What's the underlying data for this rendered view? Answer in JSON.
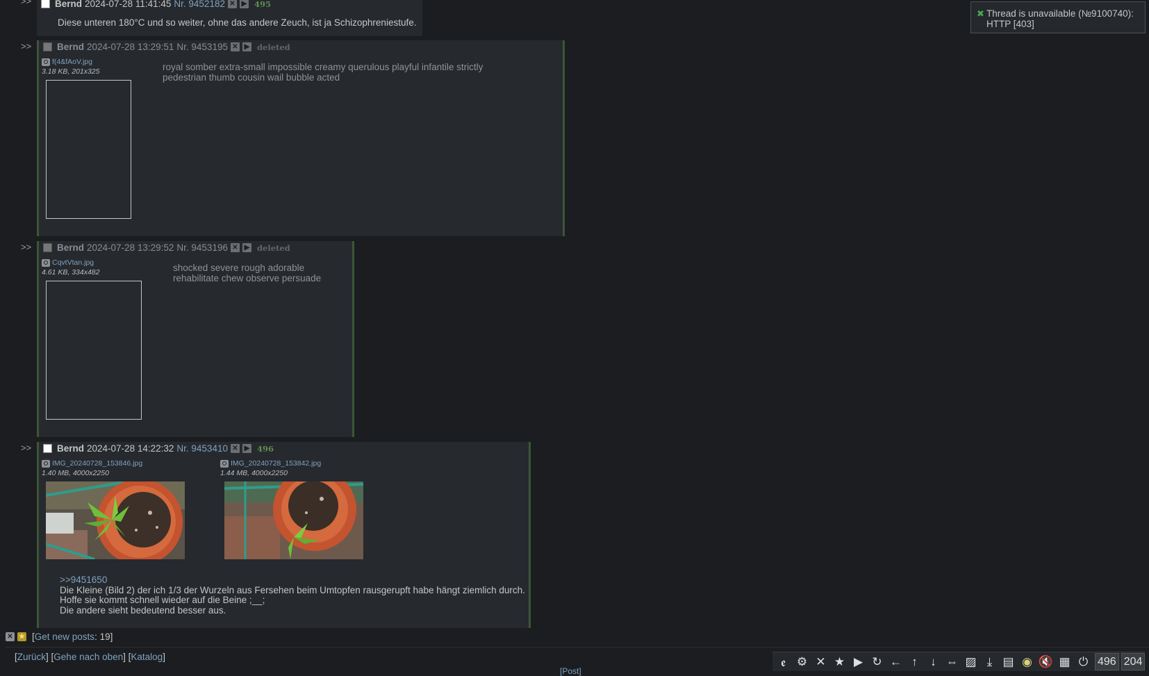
{
  "notification": {
    "icon": "close-icon",
    "text": "Thread is unavailable (№9100740): HTTP [403]"
  },
  "posts": [
    {
      "arrows": ">>",
      "name": "Bernd",
      "date": "2024-07-28 11:41:45",
      "nr_label": "Nr.",
      "nr": "9452182",
      "count": "495",
      "message": "Diese unteren 180°C und so weiter, ohne das andere Zeuch, ist ja Schizophreniestufe."
    },
    {
      "arrows": ">>",
      "name": "Bernd",
      "date": "2024-07-28 13:29:51",
      "nr_label": "Nr.",
      "nr": "9453195",
      "status": "deleted",
      "file": {
        "name": "f(4&fAoV.jpg",
        "info": "3.18 KB, 201x325"
      },
      "message": "royal somber extra-small impossible creamy querulous playful infantile strictly pedestrian thumb cousin wail bubble acted"
    },
    {
      "arrows": ">>",
      "name": "Bernd",
      "date": "2024-07-28 13:29:52",
      "nr_label": "Nr.",
      "nr": "9453196",
      "status": "deleted",
      "file": {
        "name": "CqvtVtan.jpg",
        "info": "4.61 KB, 334x482"
      },
      "message_lines": [
        "shocked severe rough adorable",
        "rehabilitate chew observe persuade"
      ]
    },
    {
      "arrows": ">>",
      "name": "Bernd",
      "date": "2024-07-28 14:22:32",
      "nr_label": "Nr.",
      "nr": "9453410",
      "count": "496",
      "files": [
        {
          "name": "IMG_20240728_153846.jpg",
          "info": "1.40 MB, 4000x2250"
        },
        {
          "name": "IMG_20240728_153842.jpg",
          "info": "1.44 MB, 4000x2250"
        }
      ],
      "quote": ">>9451650",
      "message_lines": [
        "Die Kleine (Bild 2) der ich 1/3 der Wurzeln aus Fersehen beim Umtopfen rausgerupft habe hängt ziemlich durch.",
        "Hoffe sie kommt schnell wieder auf die Beine ;__;",
        "Die andere sieht bedeutend besser aus."
      ]
    }
  ],
  "new_posts": {
    "open": "[",
    "link": "Get new posts",
    "sep": ": ",
    "count": "19",
    "close": "]"
  },
  "nav": {
    "back": "Zurück",
    "top": "Gehe nach oben",
    "catalog": "Katalog"
  },
  "toolbar": {
    "icons": [
      "logo-icon",
      "gear-icon",
      "close-icon",
      "star-icon",
      "play-icon",
      "refresh-icon",
      "arrow-left-icon",
      "arrow-up-icon",
      "arrow-down-icon",
      "expand-width-icon",
      "image-toggle-icon",
      "download-icon",
      "save-icon",
      "eye-icon",
      "mute-icon",
      "grid-icon",
      "power-icon"
    ],
    "post_count": "496",
    "file_count": "204"
  },
  "bottom_link": "[Post]"
}
